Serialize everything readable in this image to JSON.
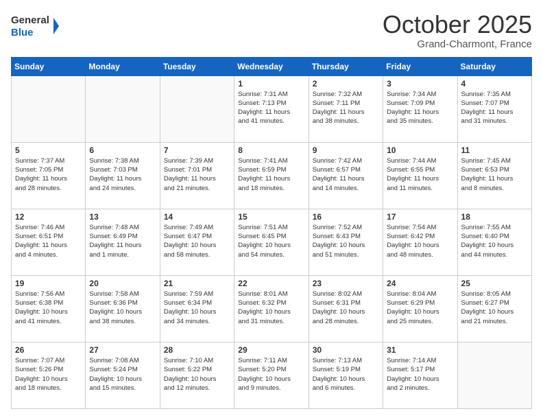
{
  "header": {
    "logo_line1": "General",
    "logo_line2": "Blue",
    "month": "October 2025",
    "location": "Grand-Charmont, France"
  },
  "weekdays": [
    "Sunday",
    "Monday",
    "Tuesday",
    "Wednesday",
    "Thursday",
    "Friday",
    "Saturday"
  ],
  "weeks": [
    [
      {
        "day": "",
        "info": ""
      },
      {
        "day": "",
        "info": ""
      },
      {
        "day": "",
        "info": ""
      },
      {
        "day": "1",
        "info": "Sunrise: 7:31 AM\nSunset: 7:13 PM\nDaylight: 11 hours\nand 41 minutes."
      },
      {
        "day": "2",
        "info": "Sunrise: 7:32 AM\nSunset: 7:11 PM\nDaylight: 11 hours\nand 38 minutes."
      },
      {
        "day": "3",
        "info": "Sunrise: 7:34 AM\nSunset: 7:09 PM\nDaylight: 11 hours\nand 35 minutes."
      },
      {
        "day": "4",
        "info": "Sunrise: 7:35 AM\nSunset: 7:07 PM\nDaylight: 11 hours\nand 31 minutes."
      }
    ],
    [
      {
        "day": "5",
        "info": "Sunrise: 7:37 AM\nSunset: 7:05 PM\nDaylight: 11 hours\nand 28 minutes."
      },
      {
        "day": "6",
        "info": "Sunrise: 7:38 AM\nSunset: 7:03 PM\nDaylight: 11 hours\nand 24 minutes."
      },
      {
        "day": "7",
        "info": "Sunrise: 7:39 AM\nSunset: 7:01 PM\nDaylight: 11 hours\nand 21 minutes."
      },
      {
        "day": "8",
        "info": "Sunrise: 7:41 AM\nSunset: 6:59 PM\nDaylight: 11 hours\nand 18 minutes."
      },
      {
        "day": "9",
        "info": "Sunrise: 7:42 AM\nSunset: 6:57 PM\nDaylight: 11 hours\nand 14 minutes."
      },
      {
        "day": "10",
        "info": "Sunrise: 7:44 AM\nSunset: 6:55 PM\nDaylight: 11 hours\nand 11 minutes."
      },
      {
        "day": "11",
        "info": "Sunrise: 7:45 AM\nSunset: 6:53 PM\nDaylight: 11 hours\nand 8 minutes."
      }
    ],
    [
      {
        "day": "12",
        "info": "Sunrise: 7:46 AM\nSunset: 6:51 PM\nDaylight: 11 hours\nand 4 minutes."
      },
      {
        "day": "13",
        "info": "Sunrise: 7:48 AM\nSunset: 6:49 PM\nDaylight: 11 hours\nand 1 minute."
      },
      {
        "day": "14",
        "info": "Sunrise: 7:49 AM\nSunset: 6:47 PM\nDaylight: 10 hours\nand 58 minutes."
      },
      {
        "day": "15",
        "info": "Sunrise: 7:51 AM\nSunset: 6:45 PM\nDaylight: 10 hours\nand 54 minutes."
      },
      {
        "day": "16",
        "info": "Sunrise: 7:52 AM\nSunset: 6:43 PM\nDaylight: 10 hours\nand 51 minutes."
      },
      {
        "day": "17",
        "info": "Sunrise: 7:54 AM\nSunset: 6:42 PM\nDaylight: 10 hours\nand 48 minutes."
      },
      {
        "day": "18",
        "info": "Sunrise: 7:55 AM\nSunset: 6:40 PM\nDaylight: 10 hours\nand 44 minutes."
      }
    ],
    [
      {
        "day": "19",
        "info": "Sunrise: 7:56 AM\nSunset: 6:38 PM\nDaylight: 10 hours\nand 41 minutes."
      },
      {
        "day": "20",
        "info": "Sunrise: 7:58 AM\nSunset: 6:36 PM\nDaylight: 10 hours\nand 38 minutes."
      },
      {
        "day": "21",
        "info": "Sunrise: 7:59 AM\nSunset: 6:34 PM\nDaylight: 10 hours\nand 34 minutes."
      },
      {
        "day": "22",
        "info": "Sunrise: 8:01 AM\nSunset: 6:32 PM\nDaylight: 10 hours\nand 31 minutes."
      },
      {
        "day": "23",
        "info": "Sunrise: 8:02 AM\nSunset: 6:31 PM\nDaylight: 10 hours\nand 28 minutes."
      },
      {
        "day": "24",
        "info": "Sunrise: 8:04 AM\nSunset: 6:29 PM\nDaylight: 10 hours\nand 25 minutes."
      },
      {
        "day": "25",
        "info": "Sunrise: 8:05 AM\nSunset: 6:27 PM\nDaylight: 10 hours\nand 21 minutes."
      }
    ],
    [
      {
        "day": "26",
        "info": "Sunrise: 7:07 AM\nSunset: 5:26 PM\nDaylight: 10 hours\nand 18 minutes."
      },
      {
        "day": "27",
        "info": "Sunrise: 7:08 AM\nSunset: 5:24 PM\nDaylight: 10 hours\nand 15 minutes."
      },
      {
        "day": "28",
        "info": "Sunrise: 7:10 AM\nSunset: 5:22 PM\nDaylight: 10 hours\nand 12 minutes."
      },
      {
        "day": "29",
        "info": "Sunrise: 7:11 AM\nSunset: 5:20 PM\nDaylight: 10 hours\nand 9 minutes."
      },
      {
        "day": "30",
        "info": "Sunrise: 7:13 AM\nSunset: 5:19 PM\nDaylight: 10 hours\nand 6 minutes."
      },
      {
        "day": "31",
        "info": "Sunrise: 7:14 AM\nSunset: 5:17 PM\nDaylight: 10 hours\nand 2 minutes."
      },
      {
        "day": "",
        "info": ""
      }
    ]
  ]
}
